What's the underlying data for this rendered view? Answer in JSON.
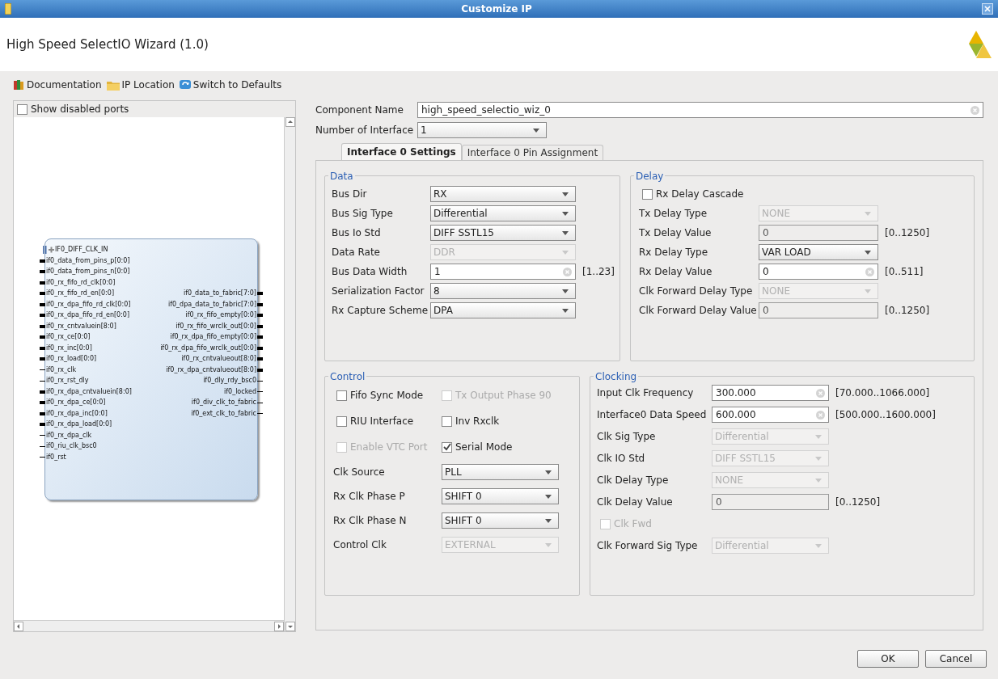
{
  "window": {
    "title": "Customize IP"
  },
  "header": {
    "title": "High Speed SelectIO Wizard (1.0)"
  },
  "toolbar": [
    {
      "label": "Documentation",
      "kind": "book"
    },
    {
      "label": "IP Location",
      "kind": "folder"
    },
    {
      "label": "Switch to Defaults",
      "kind": "refresh"
    }
  ],
  "symbol_panel": {
    "show_disabled": {
      "label": "Show disabled ports",
      "checked": false,
      "disabled": false
    },
    "interface": "IF0_DIFF_CLK_IN",
    "rows": [
      {
        "left": {
          "name": "if0_data_from_pins_p[0:0]",
          "kind": "bus"
        }
      },
      {
        "left": {
          "name": "if0_data_from_pins_n[0:0]",
          "kind": "bus"
        }
      },
      {
        "left": {
          "name": "if0_rx_fifo_rd_clk[0:0]",
          "kind": "bus"
        }
      },
      {
        "left": {
          "name": "if0_rx_fifo_rd_en[0:0]",
          "kind": "bus"
        },
        "right": {
          "name": "if0_data_to_fabric[7:0]",
          "kind": "bus"
        }
      },
      {
        "left": {
          "name": "if0_rx_dpa_fifo_rd_clk[0:0]",
          "kind": "bus"
        },
        "right": {
          "name": "if0_dpa_data_to_fabric[7:0]",
          "kind": "bus"
        }
      },
      {
        "left": {
          "name": "if0_rx_dpa_fifo_rd_en[0:0]",
          "kind": "bus"
        },
        "right": {
          "name": "if0_rx_fifo_empty[0:0]",
          "kind": "bus"
        }
      },
      {
        "left": {
          "name": "if0_rx_cntvaluein[8:0]",
          "kind": "bus"
        },
        "right": {
          "name": "if0_rx_fifo_wrclk_out[0:0]",
          "kind": "bus"
        }
      },
      {
        "left": {
          "name": "if0_rx_ce[0:0]",
          "kind": "bus"
        },
        "right": {
          "name": "if0_rx_dpa_fifo_empty[0:0]",
          "kind": "bus"
        }
      },
      {
        "left": {
          "name": "if0_rx_inc[0:0]",
          "kind": "bus"
        },
        "right": {
          "name": "if0_rx_dpa_fifo_wrclk_out[0:0]",
          "kind": "bus"
        }
      },
      {
        "left": {
          "name": "if0_rx_load[0:0]",
          "kind": "bus"
        },
        "right": {
          "name": "if0_rx_cntvalueout[8:0]",
          "kind": "bus"
        }
      },
      {
        "left": {
          "name": "if0_rx_clk",
          "kind": "wire"
        },
        "right": {
          "name": "if0_rx_dpa_cntvalueout[8:0]",
          "kind": "bus"
        }
      },
      {
        "left": {
          "name": "if0_rx_rst_dly",
          "kind": "wire"
        },
        "right": {
          "name": "if0_dly_rdy_bsc0",
          "kind": "wire"
        }
      },
      {
        "left": {
          "name": "if0_rx_dpa_cntvaluein[8:0]",
          "kind": "bus"
        },
        "right": {
          "name": "if0_locked",
          "kind": "wire"
        }
      },
      {
        "left": {
          "name": "if0_rx_dpa_ce[0:0]",
          "kind": "bus"
        },
        "right": {
          "name": "if0_div_clk_to_fabric",
          "kind": "wire"
        }
      },
      {
        "left": {
          "name": "if0_rx_dpa_inc[0:0]",
          "kind": "bus"
        },
        "right": {
          "name": "if0_ext_clk_to_fabric",
          "kind": "wire"
        }
      },
      {
        "left": {
          "name": "if0_rx_dpa_load[0:0]",
          "kind": "bus"
        }
      },
      {
        "left": {
          "name": "if0_rx_dpa_clk",
          "kind": "wire"
        }
      },
      {
        "left": {
          "name": "if0_riu_clk_bsc0",
          "kind": "wire"
        }
      },
      {
        "left": {
          "name": "if0_rst",
          "kind": "wire"
        }
      }
    ]
  },
  "component_name": {
    "label": "Component Name",
    "value": "high_speed_selectio_wiz_0"
  },
  "number_of_interface": {
    "label": "Number of Interface",
    "value": "1"
  },
  "tabs": [
    {
      "label": "Interface 0 Settings",
      "selected": true
    },
    {
      "label": "Interface 0 Pin Assignment",
      "selected": false
    }
  ],
  "data": {
    "title": "Data",
    "fields": [
      {
        "kind": "dropdown",
        "label": "Bus Dir",
        "value": "RX",
        "disabled": false
      },
      {
        "kind": "dropdown",
        "label": "Bus Sig Type",
        "value": "Differential",
        "disabled": false
      },
      {
        "kind": "dropdown",
        "label": "Bus Io Std",
        "value": "DIFF SSTL15",
        "disabled": false
      },
      {
        "kind": "dropdown",
        "label": "Data Rate",
        "value": "DDR",
        "disabled": true
      },
      {
        "kind": "text",
        "label": "Bus Data Width",
        "value": "1",
        "disabled": false,
        "range": "[1..23]"
      },
      {
        "kind": "dropdown",
        "label": "Serialization Factor",
        "value": "8",
        "disabled": false
      },
      {
        "kind": "dropdown",
        "label": "Rx Capture Scheme",
        "value": "DPA",
        "disabled": false
      }
    ]
  },
  "delay": {
    "title": "Delay",
    "fields": [
      {
        "kind": "checkbox",
        "label": "Rx Delay Cascade",
        "checked": false,
        "disabled": false
      },
      {
        "kind": "dropdown",
        "label": "Tx Delay Type",
        "value": "NONE",
        "disabled": true
      },
      {
        "kind": "text",
        "label": "Tx Delay Value",
        "value": "0",
        "disabled": true,
        "range": "[0..1250]"
      },
      {
        "kind": "dropdown",
        "label": "Rx Delay Type",
        "value": "VAR LOAD",
        "disabled": false
      },
      {
        "kind": "text",
        "label": "Rx Delay Value",
        "value": "0",
        "disabled": false,
        "range": "[0..511]"
      },
      {
        "kind": "dropdown",
        "label": "Clk Forward Delay Type",
        "value": "NONE",
        "disabled": true
      },
      {
        "kind": "text",
        "label": "Clk Forward Delay Value",
        "value": "0",
        "disabled": true,
        "range": "[0..1250]"
      }
    ]
  },
  "control": {
    "title": "Control",
    "checkboxes": [
      {
        "label": "Fifo Sync Mode",
        "checked": false,
        "disabled": false
      },
      {
        "label": "Tx Output Phase 90",
        "checked": false,
        "disabled": true
      },
      {
        "label": "RIU Interface",
        "checked": false,
        "disabled": false
      },
      {
        "label": "Inv Rxclk",
        "checked": false,
        "disabled": false
      },
      {
        "label": "Enable VTC Port",
        "checked": false,
        "disabled": true
      },
      {
        "label": "Serial Mode",
        "checked": true,
        "disabled": false
      }
    ],
    "fields": [
      {
        "kind": "dropdown",
        "label": "Clk Source",
        "value": "PLL",
        "disabled": false
      },
      {
        "kind": "dropdown",
        "label": "Rx Clk Phase P",
        "value": "SHIFT 0",
        "disabled": false
      },
      {
        "kind": "dropdown",
        "label": "Rx Clk Phase N",
        "value": "SHIFT 0",
        "disabled": false
      },
      {
        "kind": "dropdown",
        "label": "Control Clk",
        "value": "EXTERNAL",
        "disabled": true
      }
    ]
  },
  "clocking": {
    "title": "Clocking",
    "fields": [
      {
        "kind": "text",
        "label": "Input Clk Frequency",
        "value": "300.000",
        "disabled": false,
        "range": "[70.000..1066.000]"
      },
      {
        "kind": "text",
        "label": "Interface0 Data Speed",
        "value": "600.000",
        "disabled": false,
        "range": "[500.000..1600.000]"
      },
      {
        "kind": "dropdown",
        "label": "Clk Sig Type",
        "value": "Differential",
        "disabled": true
      },
      {
        "kind": "dropdown",
        "label": "Clk IO Std",
        "value": "DIFF SSTL15",
        "disabled": true
      },
      {
        "kind": "dropdown",
        "label": "Clk Delay Type",
        "value": "NONE",
        "disabled": true
      },
      {
        "kind": "text",
        "label": "Clk Delay Value",
        "value": "0",
        "disabled": true,
        "range": "[0..1250]"
      },
      {
        "kind": "checkbox",
        "label": "Clk Fwd",
        "checked": false,
        "disabled": true
      },
      {
        "kind": "dropdown",
        "label": "Clk Forward Sig Type",
        "value": "Differential",
        "disabled": true
      }
    ]
  },
  "buttons": [
    "OK",
    "Cancel"
  ]
}
